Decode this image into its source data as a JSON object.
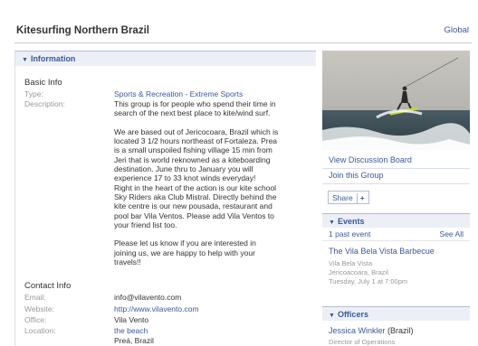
{
  "header": {
    "title": "Kitesurfing Northern Brazil",
    "global_link": "Global"
  },
  "info": {
    "header": "Information",
    "basic_info_title": "Basic Info",
    "type_label": "Type:",
    "type_value": "Sports & Recreation - Extreme Sports",
    "description_label": "Description:",
    "description_lines": [
      "This group is for people who spend their time in",
      "search of the next best place to kite/wind surf.",
      "",
      "We are based out of Jericocoara, Brazil which is",
      "located 3 1/2 hours northeast of Fortaleza. Prea",
      "is a small unspoiled fishing village 15 min from",
      "Jeri that is world reknowned as a kiteboarding",
      "destination. June thru to January you will",
      "experience 17 to 33 knot winds everyday!",
      "Right in the heart of the action is our kite school",
      "Sky Riders aka Club Mistral. Directly behind the",
      "kite centre is our new pousada, restaurant and",
      "pool bar Vila Ventos. Please add Vila Ventos to",
      "your friend list too.",
      "",
      "Please let us know if you are interested in",
      "joining us, we are happy to help with your",
      "travels!!"
    ],
    "contact_info_title": "Contact Info",
    "email_label": "Email:",
    "email_value": "info@vilavento.com",
    "website_label": "Website:",
    "website_value": "http://www.vilavento.com",
    "office_label": "Office:",
    "office_value": "Vila Vento",
    "location_label": "Location:",
    "location_value": "the beach",
    "location_value2": "Preá, Brazil"
  },
  "sidebar": {
    "view_discussion": "View Discussion Board",
    "join_group": "Join this Group",
    "share_label": "Share",
    "share_plus": "+",
    "events_header": "Events",
    "past_events": "1 past event",
    "see_all": "See All",
    "event_title": "The Vila Bela Vista Barbecue",
    "event_line1": "Vila Bela Vista",
    "event_line2": "Jericoacoara, Brazil",
    "event_line3": "Tuesday, July 1 at 7:00pm",
    "officers_header": "Officers",
    "officer_name": "Jessica Winkler",
    "officer_country": "(Brazil)",
    "officer_role": "Director of Operations"
  }
}
